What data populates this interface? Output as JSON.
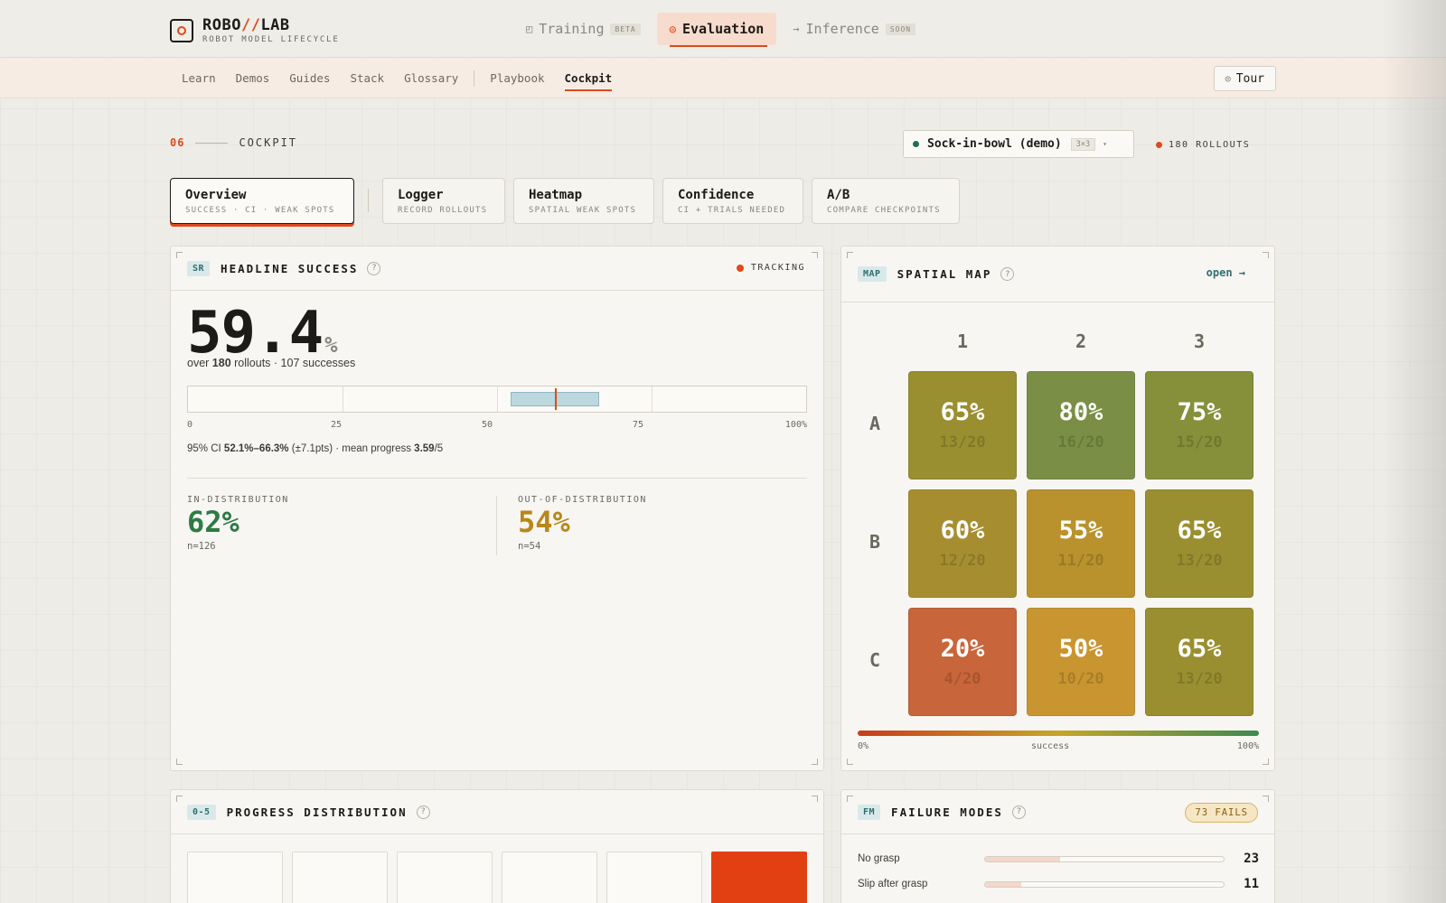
{
  "app": {
    "title_pre": "ROBO",
    "title_slash": "//",
    "title_post": "LAB",
    "subtitle": "ROBOT MODEL LIFECYCLE"
  },
  "stages": [
    {
      "label": "Training",
      "tag": "BETA",
      "icon": "square-icon"
    },
    {
      "label": "Evaluation",
      "tag": "",
      "icon": "target-icon"
    },
    {
      "label": "Inference",
      "tag": "SOON",
      "icon": "arrow-right-icon"
    }
  ],
  "subnav": {
    "items": [
      "Learn",
      "Demos",
      "Guides",
      "Stack",
      "Glossary",
      "Playbook",
      "Cockpit"
    ],
    "active": "Cockpit",
    "tour_label": "Tour"
  },
  "section": {
    "number": "06",
    "label": "COCKPIT"
  },
  "task": {
    "name": "Sock-in-bowl (demo)",
    "grid": "3×3",
    "rollouts_label": "180 ROLLOUTS"
  },
  "modes": [
    {
      "title": "Overview",
      "sub": "SUCCESS · CI · WEAK SPOTS"
    },
    {
      "title": "Logger",
      "sub": "RECORD ROLLOUTS"
    },
    {
      "title": "Heatmap",
      "sub": "SPATIAL WEAK SPOTS"
    },
    {
      "title": "Confidence",
      "sub": "CI + TRIALS NEEDED"
    },
    {
      "title": "A/B",
      "sub": "COMPARE CHECKPOINTS"
    }
  ],
  "headline": {
    "badge": "SR",
    "title": "HEADLINE SUCCESS",
    "help": "?",
    "status": "TRACKING",
    "value": "59.4",
    "unit": "%",
    "over_pre": "over ",
    "rollouts": "180",
    "over_mid": " rollouts · ",
    "successes": "107",
    "over_post": " successes",
    "ci_ticks": [
      "0",
      "25",
      "50",
      "75",
      "100%"
    ],
    "ci_low": 52.1,
    "ci_high": 66.3,
    "mean": 59.4,
    "ci_pre": "95% CI ",
    "ci_range_text": "52.1%–66.3%",
    "ci_mid": " (±7.1pts) · mean progress ",
    "mean_progress": "3.59",
    "ci_post": "/5",
    "in_dist": {
      "label": "IN-DISTRIBUTION",
      "value": "62%",
      "n": "n=126",
      "color": "#2e7a45"
    },
    "out_dist": {
      "label": "OUT-OF-DISTRIBUTION",
      "value": "54%",
      "n": "n=54",
      "color": "#b8871a"
    }
  },
  "spatial_map": {
    "badge": "MAP",
    "title": "SPATIAL MAP",
    "help": "?",
    "open_label": "open →",
    "columns": [
      "1",
      "2",
      "3"
    ],
    "rows": [
      "A",
      "B",
      "C"
    ],
    "cells": [
      [
        {
          "pct": "65%",
          "frac": "13/20",
          "color": "#9a8f30"
        },
        {
          "pct": "80%",
          "frac": "16/20",
          "color": "#7a8f45"
        },
        {
          "pct": "75%",
          "frac": "15/20",
          "color": "#86903a"
        }
      ],
      [
        {
          "pct": "60%",
          "frac": "12/20",
          "color": "#a68e30"
        },
        {
          "pct": "55%",
          "frac": "11/20",
          "color": "#b9922d"
        },
        {
          "pct": "65%",
          "frac": "13/20",
          "color": "#9a8f30"
        }
      ],
      [
        {
          "pct": "20%",
          "frac": "4/20",
          "color": "#c8653a"
        },
        {
          "pct": "50%",
          "frac": "10/20",
          "color": "#c99530"
        },
        {
          "pct": "65%",
          "frac": "13/20",
          "color": "#9a8f30"
        }
      ]
    ],
    "legend_min": "0%",
    "legend_mid": "success",
    "legend_max": "100%"
  },
  "progress_distribution": {
    "badge": "0-5",
    "title": "PROGRESS DISTRIBUTION",
    "help": "?",
    "bins": 6,
    "highlight_bin": 5
  },
  "failure_modes": {
    "badge": "FM",
    "title": "FAILURE MODES",
    "help": "?",
    "pill": "73 FAILS",
    "items": [
      {
        "label": "No grasp",
        "count": "23"
      },
      {
        "label": "Slip after grasp",
        "count": "11"
      }
    ]
  },
  "colors": {
    "accent": "#e0491c",
    "teal": "#2f6f73"
  }
}
